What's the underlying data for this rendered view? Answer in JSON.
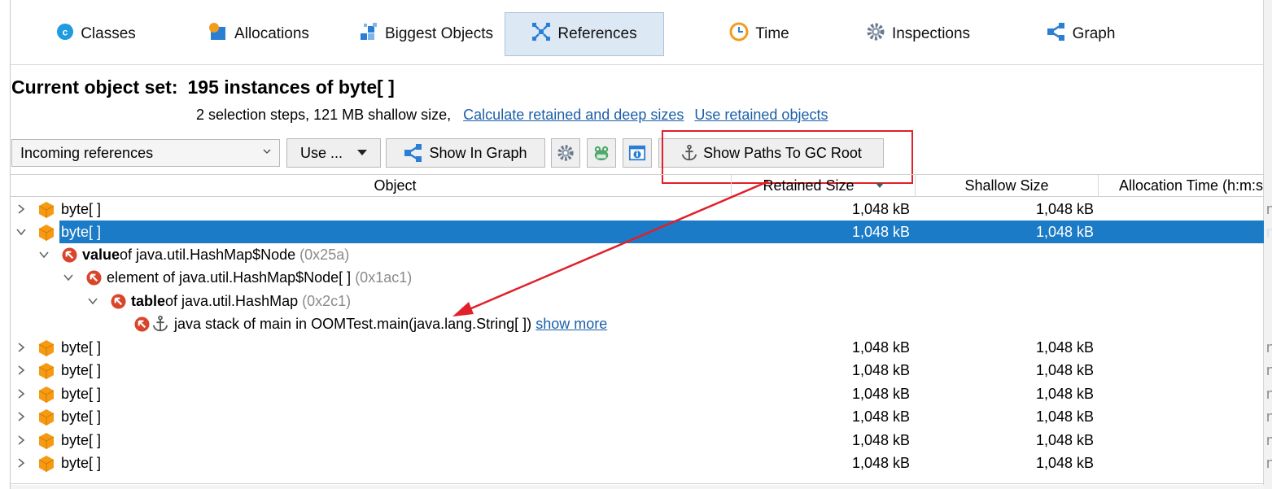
{
  "tabs": [
    {
      "label": "Classes",
      "icon": "classes-icon"
    },
    {
      "label": "Allocations",
      "icon": "allocations-icon"
    },
    {
      "label": "Biggest Objects",
      "icon": "biggest-objects-icon"
    },
    {
      "label": "References",
      "icon": "references-icon",
      "active": true
    },
    {
      "label": "Time",
      "icon": "clock-icon"
    },
    {
      "label": "Inspections",
      "icon": "gear-icon"
    },
    {
      "label": "Graph",
      "icon": "graph-icon"
    }
  ],
  "header": {
    "title_prefix": "Current object set:",
    "title_value": "195 instances of byte[ ]",
    "summary": "2 selection steps, 121 MB shallow size,",
    "link_calc": "Calculate retained and deep sizes",
    "link_use_retained": "Use retained objects"
  },
  "toolbar": {
    "view_select": "Incoming references",
    "use_button": "Use ...",
    "show_in_graph": "Show In Graph",
    "show_paths": "Show Paths To GC Root"
  },
  "table": {
    "columns": [
      "Object",
      "Retained Size",
      "Shallow Size",
      "Allocation Time (h:m:s"
    ],
    "rows": [
      {
        "name": "byte[ ]",
        "retained": "1,048 kB",
        "shallow": "1,048 kB"
      },
      {
        "name": "byte[ ]",
        "retained": "1,048 kB",
        "shallow": "1,048 kB",
        "selected": true
      },
      {
        "name": "byte[ ]",
        "retained": "1,048 kB",
        "shallow": "1,048 kB"
      },
      {
        "name": "byte[ ]",
        "retained": "1,048 kB",
        "shallow": "1,048 kB"
      },
      {
        "name": "byte[ ]",
        "retained": "1,048 kB",
        "shallow": "1,048 kB"
      },
      {
        "name": "byte[ ]",
        "retained": "1,048 kB",
        "shallow": "1,048 kB"
      },
      {
        "name": "byte[ ]",
        "retained": "1,048 kB",
        "shallow": "1,048 kB"
      },
      {
        "name": "byte[ ]",
        "retained": "1,048 kB",
        "shallow": "1,048 kB"
      }
    ],
    "tree": [
      {
        "bold": "value",
        "text": " of java.util.HashMap$Node",
        "id": "(0x25a)"
      },
      {
        "bold": "",
        "text": "element of java.util.HashMap$Node[ ]",
        "id": "(0x1ac1)"
      },
      {
        "bold": "table",
        "text": " of java.util.HashMap",
        "id": "(0x2c1)"
      },
      {
        "bold": "",
        "text": "java stack of main in OOMTest.main(java.lang.String[ ])",
        "id": "",
        "link": "show more"
      }
    ],
    "truncated_marker": "n"
  },
  "colors": {
    "accent": "#1b7bc6",
    "annotation": "#e0202a",
    "link": "#1b5fa8"
  }
}
